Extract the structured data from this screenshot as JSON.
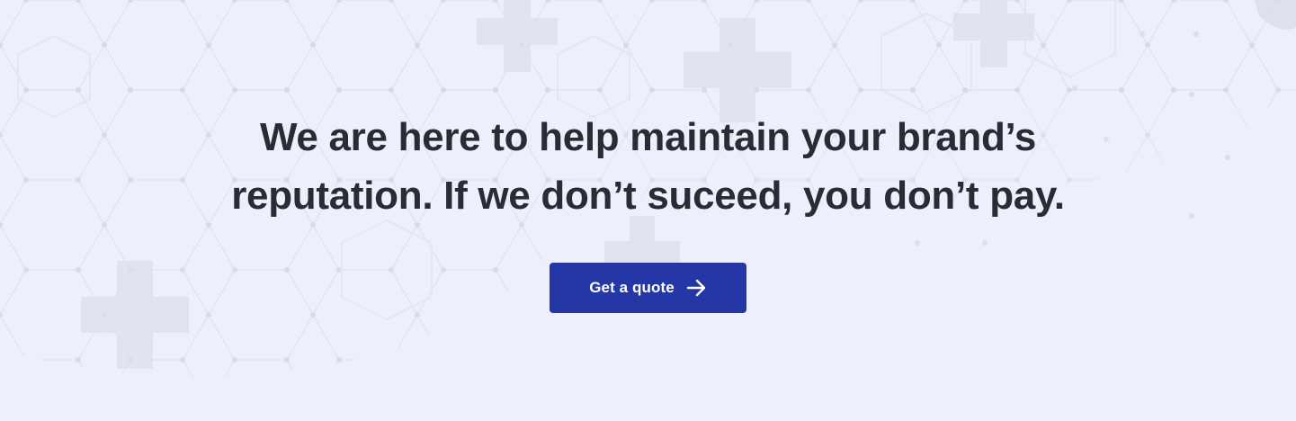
{
  "hero": {
    "headline_line1": "We are here to help maintain your brand’s",
    "headline_line2": "reputation. If we don’t suceed, you don’t pay.",
    "cta_label": "Get a quote",
    "cta_icon": "arrow-right-icon"
  },
  "colors": {
    "background": "#edeffa",
    "headline": "#2b2b36",
    "button": "#2536a6",
    "button_text": "#ffffff"
  }
}
